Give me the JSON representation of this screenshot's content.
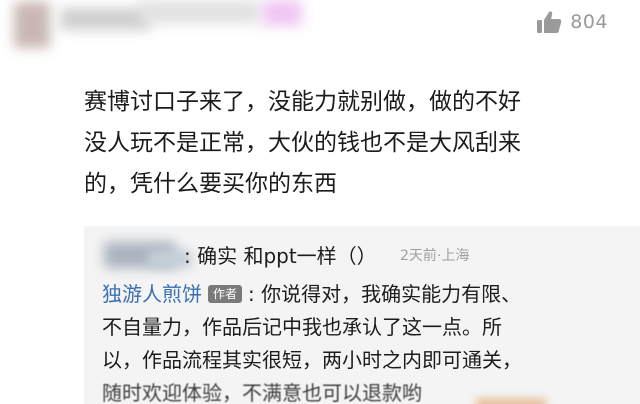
{
  "comment": {
    "like_count": "804",
    "lines": [
      "赛博讨口子来了，没能力就别做，做的不好",
      "没人玩不是正常，大伙的钱也不是大风刮来",
      "的，凭什么要买你的东西"
    ]
  },
  "reply_1": {
    "text": ": 确实 和ppt一样（）",
    "time": "2天前·上海"
  },
  "author_reply": {
    "name": "独游人煎饼",
    "badge": "作者",
    "lines": [
      ": 你说得对，我确实能力有限、",
      "不自量力，作品后记中我也承认了这一点。所",
      "以，作品流程其实很短，两小时之内即可通关，",
      "随时欢迎体验，不满意也可以退款哟"
    ]
  },
  "colors": {
    "author_name": "#3a6fb0",
    "badge_bg": "#7a7a7a",
    "reply_bg": "#f4f4f4",
    "meta_gray": "#9a9a9a"
  },
  "icons": {
    "like": "thumbs-up-icon"
  }
}
